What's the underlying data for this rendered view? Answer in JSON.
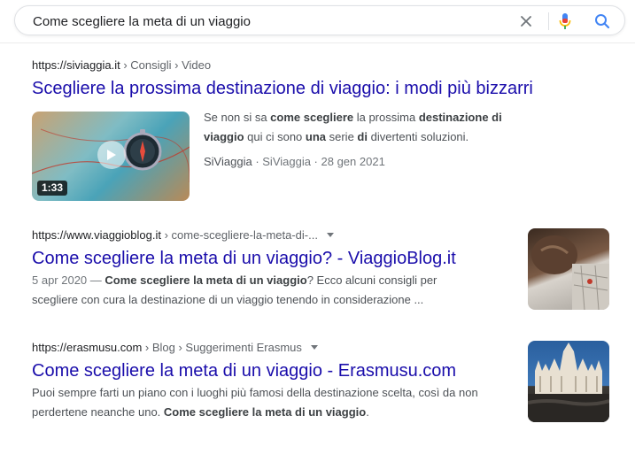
{
  "search": {
    "query": "Come scegliere la meta di un viaggio"
  },
  "colors": {
    "link": "#1a0dab",
    "snippet": "#4d5156",
    "cite": "#202124",
    "accent_blue": "#4285f4",
    "accent_red": "#ea4335"
  },
  "results": [
    {
      "cite_domain": "https://siviaggia.it",
      "cite_path": " › Consigli › Video",
      "title": "Scegliere la prossima destinazione di viaggio: i modi più bizzarri",
      "snippet_parts": [
        "Se non si sa ",
        "come scegliere",
        " la prossima ",
        "destinazione di viaggio",
        " qui ci sono ",
        "una",
        " serie ",
        "di",
        " divertenti soluzioni."
      ],
      "source": "SiViaggia",
      "source_detail": " · SiViaggia · 28 gen 2021",
      "duration": "1:33",
      "thumb_icon": "compass-map-thumbnail"
    },
    {
      "cite_domain": "https://www.viaggioblog.it",
      "cite_path": " › come-scegliere-la-meta-di-...",
      "title": "Come scegliere la meta di un viaggio? - ViaggioBlog.it",
      "date": "5 apr 2020 — ",
      "snippet_parts": [
        "Come scegliere la meta di un viaggio",
        "? Ecco alcuni consigli per scegliere con cura la destinazione di un viaggio tenendo in considerazione ..."
      ],
      "thumb_icon": "map-planning-thumbnail"
    },
    {
      "cite_domain": "https://erasmusu.com",
      "cite_path": " › Blog › Suggerimenti Erasmus",
      "title": "Come scegliere la meta di un viaggio - Erasmusu.com",
      "snippet_parts": [
        "Puoi sempre farti un piano con i luoghi più famosi della destinazione scelta, così da non perdertene neanche uno. ",
        "Come scegliere la meta di un viaggio",
        "."
      ],
      "thumb_icon": "milan-cathedral-thumbnail"
    }
  ]
}
